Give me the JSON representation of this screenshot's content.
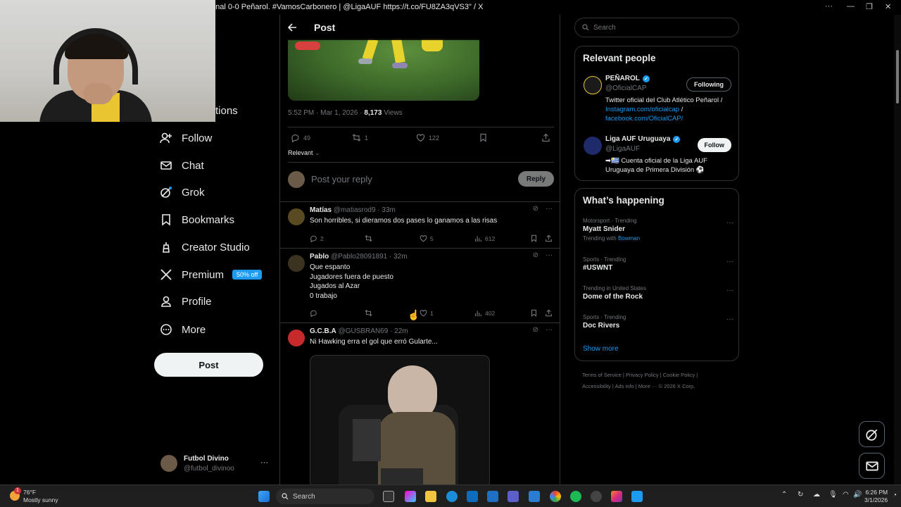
{
  "window": {
    "title": "onal 0-0 Peñarol. #VamosCarbonero | @LigaAUF https://t.co/FU8ZA3qVS3\" / X"
  },
  "sidebar": {
    "partial_item": "tions",
    "items": [
      {
        "label": "Follow",
        "icon": "follow-icon"
      },
      {
        "label": "Chat",
        "icon": "mail-icon"
      },
      {
        "label": "Grok",
        "icon": "grok-icon"
      },
      {
        "label": "Bookmarks",
        "icon": "bookmark-icon"
      },
      {
        "label": "Creator Studio",
        "icon": "creator-icon"
      },
      {
        "label": "Premium",
        "icon": "x-logo-icon",
        "badge": "50% off"
      },
      {
        "label": "Profile",
        "icon": "profile-icon"
      },
      {
        "label": "More",
        "icon": "more-icon"
      }
    ],
    "post_button": "Post",
    "account": {
      "name": "Futbol Divino",
      "handle": "@futbol_divinoo",
      "menu": "···"
    }
  },
  "main": {
    "header_title": "Post",
    "post_meta": {
      "time": "5:52 PM · Mar 1, 2026 · ",
      "views": "8,173",
      "views_label": " Views"
    },
    "post_actions": {
      "replies": "49",
      "reposts": "1",
      "likes": "122"
    },
    "sort_label": "Relevant",
    "reply_placeholder": "Post your reply",
    "reply_button": "Reply",
    "replies": [
      {
        "name": "Matías",
        "handle": "@matiasrod9 · 33m",
        "lines": [
          "Son horribles, si dieramos dos pases lo ganamos a las risas"
        ],
        "replies": "2",
        "reposts": "",
        "likes": "5",
        "views": "612"
      },
      {
        "name": "Pablo",
        "handle": "@Pablo28091891 · 32m",
        "lines": [
          "Que espanto",
          "Jugadores fuera de puesto",
          "Jugados al Azar",
          "0 trabajo"
        ],
        "replies": "",
        "reposts": "",
        "likes": "1",
        "views": "402"
      },
      {
        "name": "G.C.B.A",
        "handle": "@GUSBRAN69 · 22m",
        "lines": [
          "Ni Hawking erra el gol que erró Gularte..."
        ]
      }
    ]
  },
  "right": {
    "search_placeholder": "Search",
    "relevant_people": {
      "title": "Relevant people",
      "people": [
        {
          "name": "PEÑAROL",
          "handle": "@OficialCAP",
          "button": "Following",
          "bio_text": "Twitter oficial del Club Atlético Peñarol / ",
          "bio_link1": "Instagram.com/oficialcap",
          "bio_sep": " / ",
          "bio_link2": "facebook.com/OficialCAP/"
        },
        {
          "name": "Liga AUF Uruguaya",
          "handle": "@LigaAUF",
          "button": "Follow",
          "bio_text": "➡🇺🇾 Cuenta oficial de la Liga AUF Uruguaya de Primera División ⚽"
        }
      ]
    },
    "whats_happening": {
      "title": "What’s happening",
      "trends": [
        {
          "context": "Motorsport · Trending",
          "title": "Myatt Snider",
          "with_label": "Trending with ",
          "with": "Bowman"
        },
        {
          "context": "Sports · Trending",
          "title": "#USWNT"
        },
        {
          "context": "Trending in United States",
          "title": "Dome of the Rock"
        },
        {
          "context": "Sports · Trending",
          "title": "Doc Rivers"
        }
      ],
      "show_more": "Show more"
    },
    "footer_line1": "Terms of Service  |  Privacy Policy  |  Cookie Policy  |",
    "footer_line2": "Accessibility  |  Ads info  |  More ···  © 2026 X Corp."
  },
  "taskbar": {
    "weather_temp": "76°F",
    "weather_desc": "Mostly sunny",
    "search": "Search",
    "time": "6:26 PM",
    "date": "3/1/2026",
    "notification_count": "1"
  },
  "colors": {
    "accent": "#1d9bf0",
    "border": "#2f3336",
    "muted": "#71767b",
    "text": "#e7e9ea"
  }
}
